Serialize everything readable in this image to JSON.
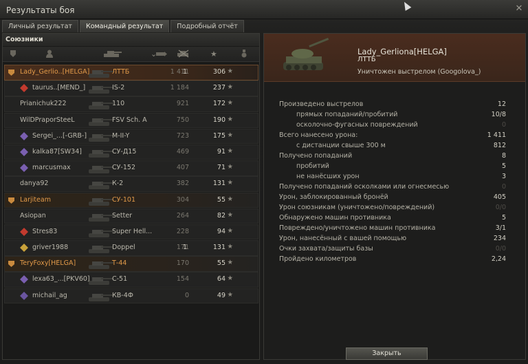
{
  "window": {
    "title": "Результаты боя"
  },
  "tabs": [
    {
      "label": "Личный результат",
      "active": false
    },
    {
      "label": "Командный результат",
      "active": true
    },
    {
      "label": "Подробный отчёт",
      "active": false
    }
  ],
  "team": {
    "section_title": "Союзники",
    "columns": [
      "platoon-icon",
      "player-icon",
      "vehicle-icon",
      "damage-icon",
      "frags-icon",
      "xp-star-icon",
      "medal-icon"
    ],
    "rows": [
      {
        "name": "Lady_Gerlio..[HELGA]",
        "tank": "ЛТТБ",
        "damage": "1 411",
        "frags": "1",
        "xp": "306",
        "style": "self",
        "platoon": true
      },
      {
        "name": "taurus..[MEND_]",
        "tank": "IS-2",
        "damage": "1 184",
        "frags": "",
        "xp": "237",
        "style": "normal",
        "rank": "red"
      },
      {
        "name": "Prianichuk222",
        "tank": "110",
        "damage": "921",
        "frags": "",
        "xp": "172",
        "style": "normal"
      },
      {
        "name": "WilDPraporSteeL",
        "tank": "FSV Sch. A",
        "damage": "750",
        "frags": "",
        "xp": "190",
        "style": "normal"
      },
      {
        "name": "Sergei_...[-GRB-]",
        "tank": "M-II-Y",
        "damage": "723",
        "frags": "",
        "xp": "175",
        "style": "normal",
        "rank": "purple"
      },
      {
        "name": "kalka87[SW34]",
        "tank": "СУ-Д15",
        "damage": "469",
        "frags": "",
        "xp": "91",
        "style": "normal",
        "rank": "purple"
      },
      {
        "name": "marcusmax",
        "tank": "СУ-152",
        "damage": "407",
        "frags": "",
        "xp": "71",
        "style": "normal",
        "rank": "purple"
      },
      {
        "name": "danya92",
        "tank": "К-2",
        "damage": "382",
        "frags": "",
        "xp": "131",
        "style": "normal"
      },
      {
        "name": "Larjiteam",
        "tank": "СУ-101",
        "damage": "304",
        "frags": "",
        "xp": "55",
        "style": "platoon",
        "platoon": true
      },
      {
        "name": "Asiopan",
        "tank": "Setter",
        "damage": "264",
        "frags": "",
        "xp": "82",
        "style": "normal"
      },
      {
        "name": "Stres83",
        "tank": "Super Hell...",
        "damage": "228",
        "frags": "",
        "xp": "94",
        "style": "normal",
        "rank": "red"
      },
      {
        "name": "griver1988",
        "tank": "Doppel",
        "damage": "171",
        "frags": "1",
        "xp": "131",
        "style": "normal",
        "rank": "gold"
      },
      {
        "name": "TeryFoxy[HELGA]",
        "tank": "Т-44",
        "damage": "170",
        "frags": "",
        "xp": "55",
        "style": "platoon",
        "platoon": true
      },
      {
        "name": "lexa63_...[PKV60]",
        "tank": "С-51",
        "damage": "154",
        "frags": "",
        "xp": "64",
        "style": "normal",
        "rank": "purple"
      },
      {
        "name": "michail_ag",
        "tank": "КВ-4Ф",
        "damage": "0",
        "frags": "",
        "xp": "49",
        "style": "normal",
        "rank": "purple-b"
      }
    ]
  },
  "player": {
    "name": "Lady_Gerliona[HELGA]",
    "tank": "ЛТТБ",
    "killed_by": "Уничтожен выстрелом (Googolova_)"
  },
  "stats": [
    {
      "label": "Произведено выстрелов",
      "value": "12",
      "sub": false,
      "dim": false
    },
    {
      "label": "прямых попаданий/пробитий",
      "value": "10/8",
      "sub": true,
      "dim": false
    },
    {
      "label": "осколочно-фугасных повреждений",
      "value": "0",
      "sub": true,
      "dim": true
    },
    {
      "label": "Всего нанесено урона:",
      "value": "1 411",
      "sub": false,
      "dim": false
    },
    {
      "label": "с дистанции свыше 300 м",
      "value": "812",
      "sub": true,
      "dim": false
    },
    {
      "label": "Получено попаданий",
      "value": "8",
      "sub": false,
      "dim": false
    },
    {
      "label": "пробитий",
      "value": "5",
      "sub": true,
      "dim": false
    },
    {
      "label": "не нанёсших урон",
      "value": "3",
      "sub": true,
      "dim": false
    },
    {
      "label": "Получено попаданий осколками или огнесмесью",
      "value": "0",
      "sub": false,
      "dim": true
    },
    {
      "label": "Урон, заблокированный бронёй",
      "value": "405",
      "sub": false,
      "dim": false
    },
    {
      "label": "Урон союзникам (уничтожено/повреждений)",
      "value": "0/0",
      "sub": false,
      "dim": true
    },
    {
      "label": "Обнаружено машин противника",
      "value": "5",
      "sub": false,
      "dim": false
    },
    {
      "label": "Повреждено/уничтожено машин противника",
      "value": "3/1",
      "sub": false,
      "dim": false
    },
    {
      "label": "Урон, нанесённый с вашей помощью",
      "value": "234",
      "sub": false,
      "dim": false
    },
    {
      "label": "Очки захвата/защиты базы",
      "value": "0/0",
      "sub": false,
      "dim": true
    },
    {
      "label": "Пройдено километров",
      "value": "2,24",
      "sub": false,
      "dim": false
    }
  ],
  "buttons": {
    "close": "Закрыть"
  },
  "colors": {
    "self_name": "#e39b4a",
    "accent": "#4a2c1e"
  }
}
